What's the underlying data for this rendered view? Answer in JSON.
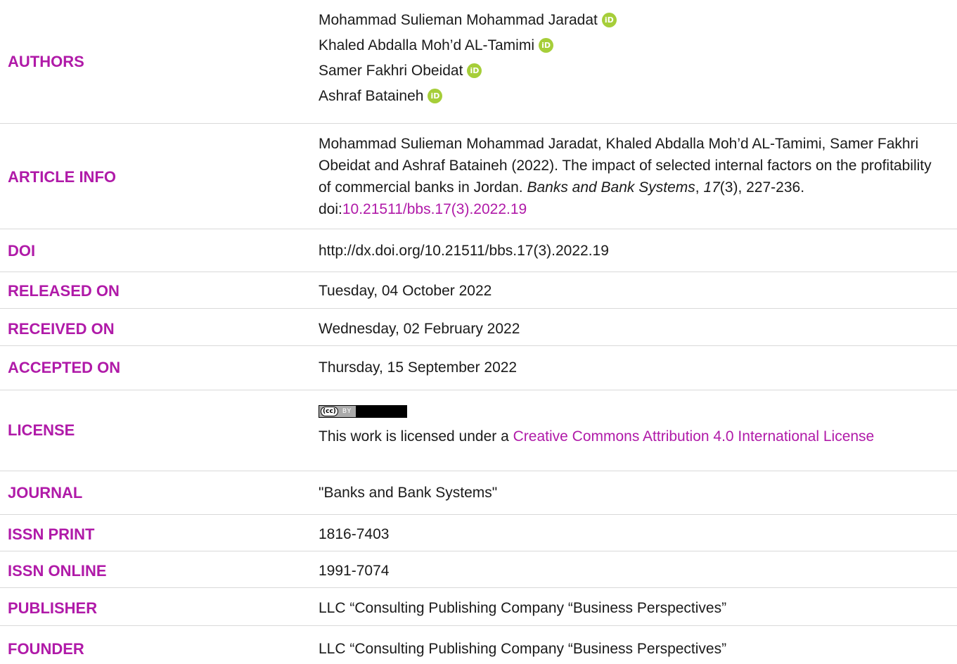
{
  "rows": {
    "authors": {
      "label": "AUTHORS",
      "items": [
        "Mohammad Sulieman Mohammad Jaradat",
        "Khaled Abdalla Moh’d AL-Tamimi",
        "Samer Fakhri Obeidat",
        "Ashraf Bataineh"
      ],
      "orcid_glyph": "iD"
    },
    "article_info": {
      "label": "ARTICLE INFO",
      "citation_plain": "Mohammad Sulieman Mohammad Jaradat, Khaled Abdalla Moh’d AL-Tamimi, Samer Fakhri Obeidat and Ashraf Bataineh (2022). The impact of selected internal factors on the profitability of commercial banks in Jordan. ",
      "journal_italic": "Banks and Bank Systems",
      "sep1": ", ",
      "volume_italic": "17",
      "rest": "(3), 227-236. doi:",
      "doi_link": "10.21511/bbs.17(3).2022.19"
    },
    "doi": {
      "label": "DOI",
      "value": "http://dx.doi.org/10.21511/bbs.17(3).2022.19"
    },
    "released_on": {
      "label": "RELEASED ON",
      "value": "Tuesday, 04 October 2022"
    },
    "received_on": {
      "label": "RECEIVED ON",
      "value": "Wednesday, 02 February 2022"
    },
    "accepted_on": {
      "label": "ACCEPTED ON",
      "value": "Thursday, 15 September 2022"
    },
    "license": {
      "label": "LICENSE",
      "badge_cc": "(cc)",
      "badge_by": "BY",
      "text": "This work is licensed under a ",
      "link": "Creative Commons Attribution 4.0 International License"
    },
    "journal": {
      "label": "JOURNAL",
      "value": "\"Banks and Bank Systems\""
    },
    "issn_print": {
      "label": "ISSN PRINT",
      "value": "1816-7403"
    },
    "issn_online": {
      "label": "ISSN ONLINE",
      "value": "1991-7074"
    },
    "publisher": {
      "label": "PUBLISHER",
      "value": "LLC “Consulting Publishing Company “Business Perspectives”"
    },
    "founder": {
      "label": "FOUNDER",
      "value": "LLC “Consulting Publishing Company “Business Perspectives”"
    }
  },
  "colors": {
    "label": "#b01aa8",
    "link": "#b01aa8",
    "orcid": "#a6ce39",
    "divider": "#d9d9d9"
  }
}
